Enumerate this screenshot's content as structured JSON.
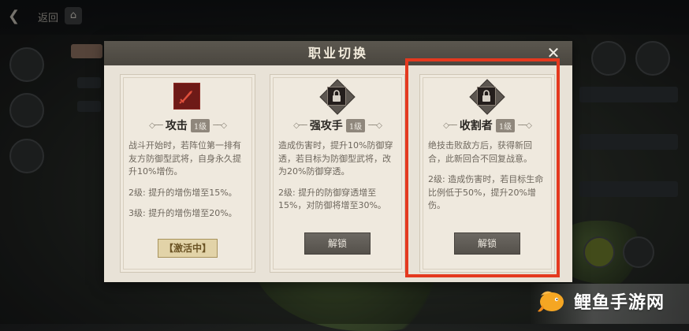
{
  "hud": {
    "back_label": "返回",
    "home_icon": "home-icon"
  },
  "dialog": {
    "title": "职业切换",
    "close_glyph": "✕"
  },
  "cards": [
    {
      "name": "攻击",
      "level": "1级",
      "icon": "attack-sword-icon",
      "locked": false,
      "desc": [
        "战斗开始时，若阵位第一排有友方防御型武将，自身永久提升10%增伤。",
        "2级: 提升的增伤增至15%。",
        "3级: 提升的增伤增至20%。"
      ],
      "action_label": "【激活中】"
    },
    {
      "name": "强攻手",
      "level": "1级",
      "icon": "lock-icon",
      "locked": true,
      "desc": [
        "造成伤害时，提升10%防御穿透，若目标为防御型武将，改为20%防御穿透。",
        "2级: 提升的防御穿透增至15%，对防御将增至30%。"
      ],
      "action_label": "解锁"
    },
    {
      "name": "收割者",
      "level": "1级",
      "icon": "lock-icon",
      "locked": true,
      "desc": [
        "绝技击败敌方后，获得新回合，此新回合不回复战意。",
        "2级: 造成伤害时，若目标生命比例低于50%，提升20%增伤。"
      ],
      "action_label": "解锁"
    }
  ],
  "watermark": {
    "text": "鲤鱼手游网"
  },
  "colors": {
    "highlight": "#e4391f",
    "header_bg": "#524e47",
    "card_bg": "#efe9de",
    "icon_red": "#6e1a17"
  }
}
